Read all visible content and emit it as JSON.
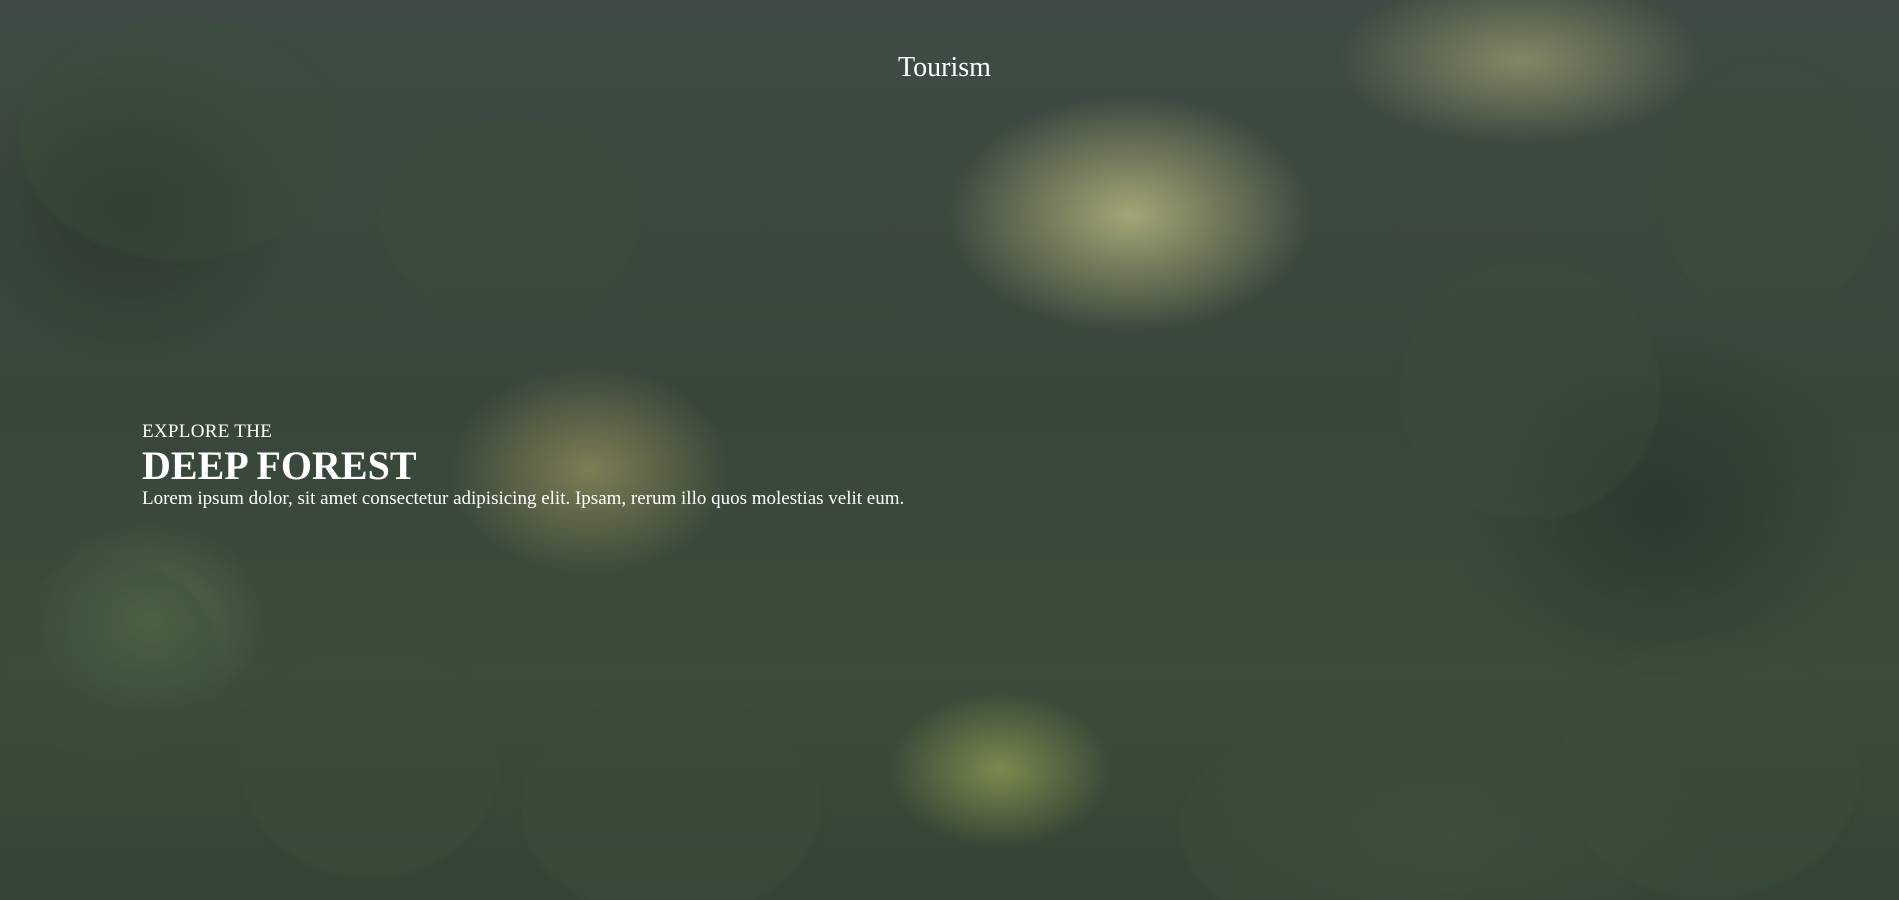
{
  "header": {
    "brand": "Tourism"
  },
  "hero": {
    "eyebrow": "EXPLORE THE",
    "headline": "DEEP FOREST",
    "lede": "Lorem ipsum dolor, sit amet consectetur adipisicing elit. Ipsam, rerum illo quos molestias velit eum.",
    "background": "forest-with-mist-image"
  },
  "colors": {
    "text": "#ffffff",
    "forest": "#3d4a3c",
    "mist": "#cecc8e"
  }
}
